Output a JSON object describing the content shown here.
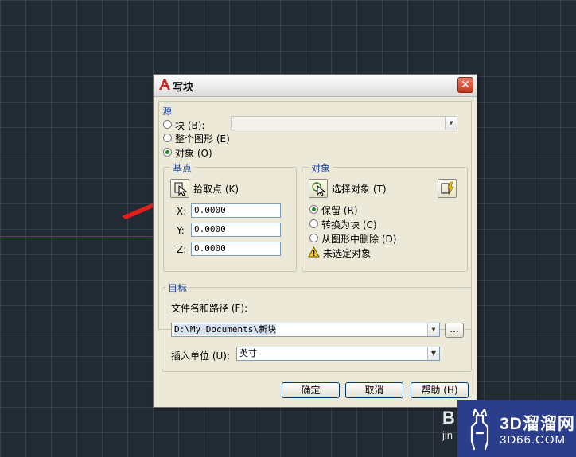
{
  "dialog": {
    "title": "写块",
    "close": "✕"
  },
  "source": {
    "label": "源",
    "block": "块 (B):",
    "whole_drawing": "整个图形 (E)",
    "objects": "对象 (O)",
    "selected": "objects"
  },
  "base_point": {
    "label": "基点",
    "pick_point": "拾取点 (K)",
    "x_label": "X:",
    "x_value": "0.0000",
    "y_label": "Y:",
    "y_value": "0.0000",
    "z_label": "Z:",
    "z_value": "0.0000"
  },
  "objects": {
    "label": "对象",
    "select_objects": "选择对象 (T)",
    "retain": "保留 (R)",
    "convert_to_block": "转换为块 (C)",
    "delete_from_drawing": "从图形中删除 (D)",
    "warning": "未选定对象",
    "selected": "retain"
  },
  "destination": {
    "label": "目标",
    "filename_label": "文件名和路径 (F):",
    "filename_value": "D:\\My Documents\\新块",
    "browse": "...",
    "units_label": "插入单位 (U):",
    "units_value": "英寸"
  },
  "buttons": {
    "ok": "确定",
    "cancel": "取消",
    "help": "帮助 (H)"
  },
  "watermark": {
    "letters_b": "B",
    "letters_jin": "jin",
    "brand": "3D溜溜网",
    "sub": "3D66.COM"
  },
  "icons": {
    "app": "autocad-icon",
    "pick": "pick-point-icon",
    "select": "select-objects-icon",
    "quick_select": "quick-select-icon",
    "warning": "warning-icon",
    "deer": "deer-logo-icon",
    "arrow": "red-arrow-icon"
  },
  "colors": {
    "grid_bg": "#222a33",
    "red_line": "#d21414",
    "group_label": "#1e46a0",
    "watermark_bg": "#2b3e8c"
  }
}
